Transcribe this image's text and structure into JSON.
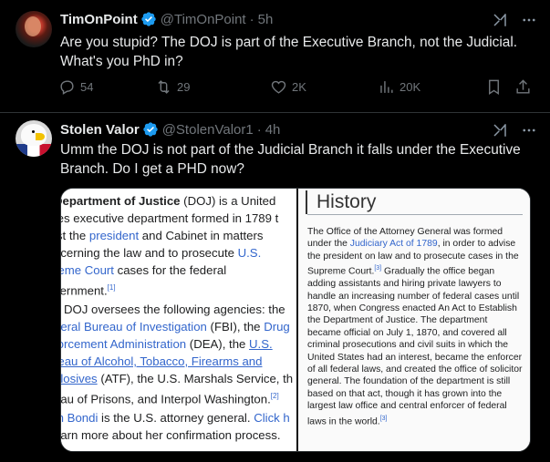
{
  "tweets": [
    {
      "name": "TimOnPoint",
      "handle": "@TimOnPoint",
      "sep": "·",
      "time": "5h",
      "text_line1": "Are you stupid? The DOJ is part of the Executive Branch, not the Judicial.",
      "text_line2": "What's you PhD in?",
      "replies": "54",
      "retweets": "29",
      "likes": "2K",
      "views": "20K"
    },
    {
      "name": "Stolen Valor",
      "handle": "@StolenValor1",
      "sep": "·",
      "time": "4h",
      "text_line1": "Umm the DOJ is not part of the Judicial Branch it falls under the Executive",
      "text_line2": "Branch. Do I get a PHD now?"
    }
  ],
  "media": {
    "left": {
      "l1a": "Department of Justice",
      "l1b": " (DOJ) is a United",
      "l2": "tes executive department formed in 1789 t",
      "l3a": "ist the ",
      "l3b": "president",
      "l3c": " and Cabinet in matters",
      "l4a": "ncerning the law and to prosecute ",
      "l4b": "U.S.",
      "l5a": "reme Court",
      "l5b": " cases for the federal",
      "l6a": "vernment.",
      "l6b": "[1]",
      "l7": "e DOJ oversees the following agencies: the",
      "l8a": "deral Bureau of Investigation",
      "l8b": " (FBI), the ",
      "l8c": "Drug",
      "l9a": "forcement Administration",
      "l9b": " (DEA), the ",
      "l9c": "U.S.",
      "l10": "reau of Alcohol, Tobacco, Firearms and",
      "l11a": "plosives",
      "l11b": " (ATF), the U.S. Marshals Service, th",
      "l12a": "eau of Prisons, and Interpol Washington.",
      "l12b": "[2]",
      "l13a": "m Bondi",
      "l13b": " is the U.S. attorney general. ",
      "l13c": "Click h",
      "l14": "earn more about her confirmation process."
    },
    "right": {
      "heading": "History",
      "p1": "The Office of the Attorney General was formed under the ",
      "p1_link": "Judiciary Act of 1789",
      "p2": ", in order to advise the president on law and to prosecute cases in the Supreme Court.",
      "ref1": "[3]",
      "p3": " Gradually the office began adding assistants and hiring private lawyers to handle an increasing number of federal cases until 1870, when Congress enacted An Act to Establish the Department of Justice. The department became official on July 1, 1870, and covered all criminal prosecutions and civil suits in which the United States had an interest, became the enforcer of all federal laws, and created the office of solicitor general. The foundation of the department is still based on that act, though it has grown into the largest law office and central enforcer of federal laws in the world.",
      "ref2": "[3]"
    }
  },
  "colors": {
    "accent": "#1d9bf0",
    "muted": "#71767b",
    "text": "#e7e9ea",
    "link": "#3366cc"
  },
  "icons": [
    "verified-badge-icon",
    "grok-icon",
    "more-icon",
    "reply-icon",
    "retweet-icon",
    "like-icon",
    "views-icon",
    "bookmark-icon",
    "share-icon"
  ]
}
